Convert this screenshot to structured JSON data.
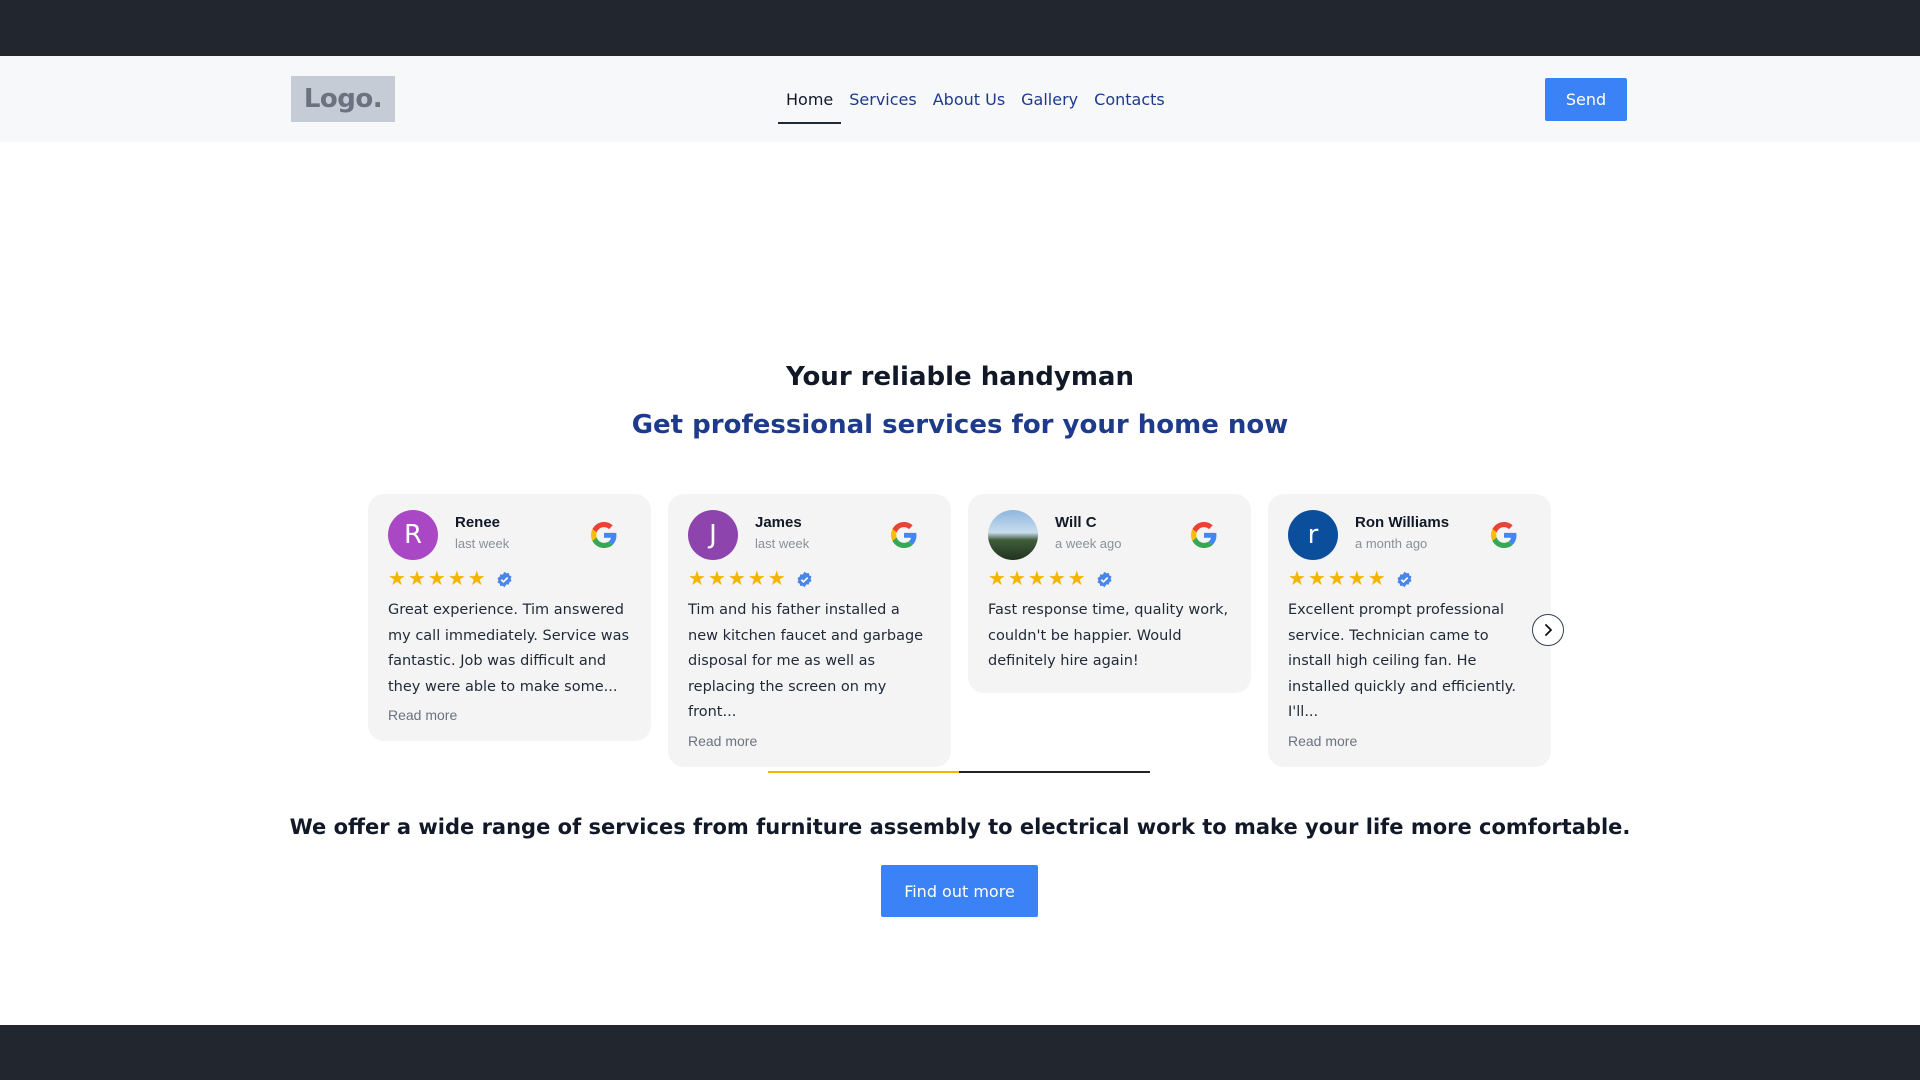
{
  "header": {
    "logo_text": "Logo.",
    "nav": [
      {
        "label": "Home",
        "active": true
      },
      {
        "label": "Services",
        "active": false
      },
      {
        "label": "About Us",
        "active": false
      },
      {
        "label": "Gallery",
        "active": false
      },
      {
        "label": "Contacts",
        "active": false
      }
    ],
    "send_label": "Send"
  },
  "hero": {
    "title": "Your reliable handyman",
    "subtitle": "Get professional services for your home now"
  },
  "reviews": {
    "items": [
      {
        "initial": "R",
        "avatar_color": "#a947c4",
        "name": "Renee",
        "time": "last week",
        "rating": 5,
        "text": "Great experience. Tim answered my call immediately. Service was fantastic. Job was difficult and they were able to make some...",
        "read_more": "Read more"
      },
      {
        "initial": "J",
        "avatar_color": "#8e44ad",
        "name": "James",
        "time": "last week",
        "rating": 5,
        "text": "Tim and his father installed a new kitchen faucet and garbage disposal for me as well as replacing the screen on my front...",
        "read_more": "Read more"
      },
      {
        "initial": "",
        "avatar_color": "",
        "name": "Will C",
        "time": "a week ago",
        "rating": 5,
        "text": "Fast response time, quality work, couldn't be happier. Would definitely hire again!",
        "read_more": ""
      },
      {
        "initial": "r",
        "avatar_color": "#0b4f9c",
        "name": "Ron Williams",
        "time": "a month ago",
        "rating": 5,
        "text": "Excellent prompt professional service. Technician came to install high ceiling fan. He installed quickly and efficiently. I'll...",
        "read_more": "Read more"
      }
    ],
    "carousel_progress": 0.5
  },
  "offer": {
    "text": "We offer a wide range of services from furniture assembly to electrical work to make your life more comfortable.",
    "button_label": "Find out more"
  },
  "colors": {
    "accent": "#3b82f6",
    "dark_bar": "#22272f",
    "nav_link": "#1e3a8a",
    "star": "#f5b400"
  },
  "icons": {
    "provider": "google-g-icon",
    "verified": "verified-badge-icon",
    "next": "chevron-right-icon"
  }
}
